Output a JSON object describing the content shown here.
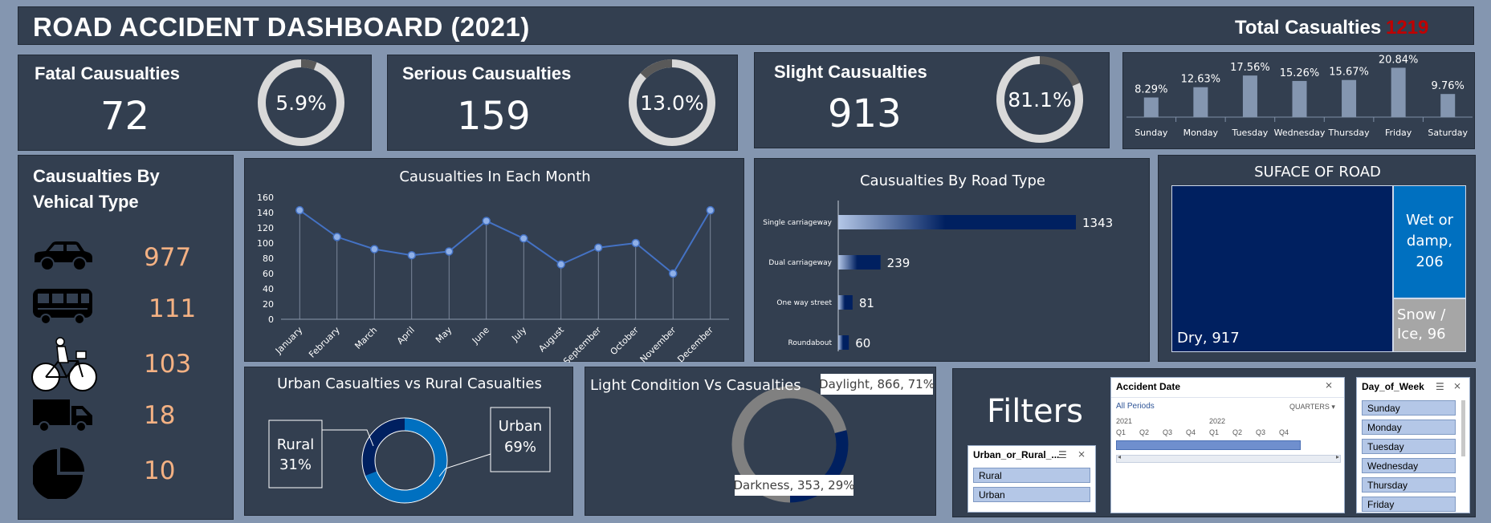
{
  "header": {
    "title": "ROAD ACCIDENT DASHBOARD (2021)",
    "total_label": "Total Casualties",
    "total_value": "1219"
  },
  "kpis": [
    {
      "title": "Fatal Causualties",
      "value": "72",
      "percent_label": "5.9%",
      "percent": 5.9
    },
    {
      "title": "Serious Causualties",
      "value": "159",
      "percent_label": "13.0%",
      "percent": 13.0
    },
    {
      "title": "Slight Causualties",
      "value": "913",
      "percent_label": "81.1%",
      "percent": 81.1
    }
  ],
  "vehicles": {
    "title_line1": "Causualties By",
    "title_line2": "Vehical Type",
    "items": [
      {
        "icon": "car-icon",
        "value": "977"
      },
      {
        "icon": "bus-icon",
        "value": "111"
      },
      {
        "icon": "bicycle-icon",
        "value": "103"
      },
      {
        "icon": "truck-icon",
        "value": "18"
      },
      {
        "icon": "pie-chart-icon",
        "value": "10"
      }
    ]
  },
  "filters": {
    "title": "Filters",
    "area_slicer": {
      "header": "Urban_or_Rural_...",
      "items": [
        "Rural",
        "Urban"
      ]
    },
    "date_slicer": {
      "header": "Accident Date",
      "all_periods": "All Periods",
      "level": "QUARTERS",
      "years": [
        "2021",
        "2022"
      ],
      "quarters": [
        "Q1",
        "Q2",
        "Q3",
        "Q4",
        "Q1",
        "Q2",
        "Q3",
        "Q4"
      ]
    },
    "day_slicer": {
      "header": "Day_of_Week",
      "items": [
        "Sunday",
        "Monday",
        "Tuesday",
        "Wednesday",
        "Thursday",
        "Friday"
      ]
    }
  },
  "colors": {
    "panel": "#333f50",
    "background": "#8496b0",
    "accent_value": "#f4b183",
    "total_red": "#c00000",
    "navy": "#002060",
    "blue": "#0070c0",
    "line": "#4472c4"
  },
  "chart_data": [
    {
      "type": "bar",
      "categories": [
        "Sunday",
        "Monday",
        "Tuesday",
        "Wednesday",
        "Thursday",
        "Friday",
        "Saturday"
      ],
      "values": [
        8.29,
        12.63,
        17.56,
        15.26,
        15.67,
        20.84,
        9.76
      ],
      "data_labels": [
        "8.29%",
        "12.63%",
        "17.56%",
        "15.26%",
        "15.67%",
        "20.84%",
        "9.76%"
      ],
      "title": "",
      "xlabel": "",
      "ylabel": ""
    },
    {
      "type": "line",
      "title": "Causualties In Each Month",
      "categories": [
        "January",
        "February",
        "March",
        "April",
        "May",
        "June",
        "July",
        "August",
        "September",
        "October",
        "November",
        "December"
      ],
      "values": [
        143,
        108,
        92,
        84,
        89,
        129,
        106,
        72,
        94,
        100,
        60,
        143
      ],
      "ylim": [
        0,
        160
      ],
      "yticks": [
        "0",
        "20",
        "40",
        "60",
        "80",
        "100",
        "120",
        "140",
        "160"
      ],
      "grid": false
    },
    {
      "type": "bar",
      "orientation": "horizontal",
      "title": "Causualties By Road  Type",
      "categories": [
        "Single carriageway",
        "Dual carriageway",
        "One way street",
        "Roundabout"
      ],
      "values": [
        1343,
        239,
        81,
        60
      ]
    },
    {
      "type": "heatmap",
      "subtype": "treemap",
      "title": "SUFACE OF ROAD",
      "categories": [
        "Dry",
        "Wet or damp",
        "Snow / Ice"
      ],
      "labels": [
        "Dry, 917",
        "Wet or damp, 206",
        "Snow / Ice, 96"
      ],
      "values": [
        917,
        206,
        96
      ]
    },
    {
      "type": "pie",
      "subtype": "doughnut",
      "title": "Urban Casualties vs Rural Casualties",
      "categories": [
        "Rural",
        "Urban"
      ],
      "values": [
        31,
        69
      ],
      "labels": [
        "Rural",
        "Urban"
      ],
      "percent_labels": [
        "31%",
        "69%"
      ]
    },
    {
      "type": "pie",
      "subtype": "doughnut",
      "title": "Light Condition Vs Casualties",
      "categories": [
        "Daylight",
        "Darkness"
      ],
      "values": [
        866,
        353
      ],
      "labels": [
        "Daylight, 866, 71%",
        "Darkness, 353, 29%"
      ]
    }
  ]
}
